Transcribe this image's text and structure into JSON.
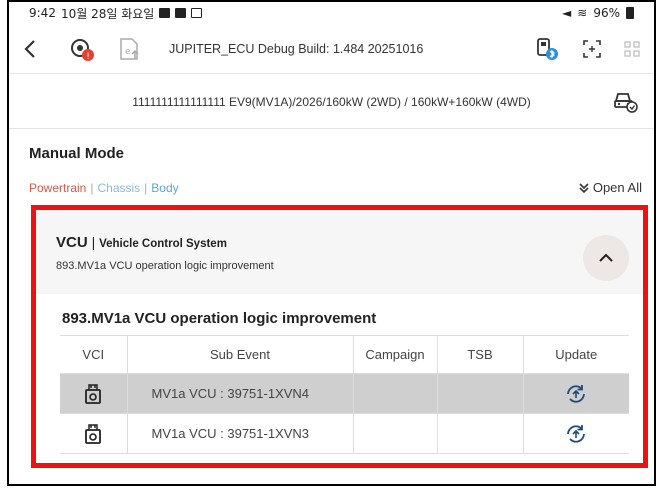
{
  "status_bar": {
    "time": "9:42",
    "date": "10월 28일 화요일",
    "battery": "96%"
  },
  "app_bar": {
    "title": "JUPITER_ECU Debug Build: 1.484 20251016",
    "icons": [
      "back-icon",
      "ecu-scan-icon",
      "file-upload-icon",
      "vci-bluetooth-icon",
      "fullscreen-icon",
      "grid-icon"
    ]
  },
  "vehicle": {
    "info": "1111111111111111  EV9(MV1A)/2026/160kW (2WD) / 160kW+160kW (4WD)"
  },
  "main": {
    "section_title": "Manual Mode",
    "categories": [
      "Powertrain",
      "Chassis",
      "Body"
    ],
    "open_all": "Open All",
    "card": {
      "system_code": "VCU",
      "system_name": "Vehicle Control System",
      "description": "893.MV1a VCU operation logic improvement",
      "group_title": "893.MV1a VCU operation logic improvement",
      "columns": [
        "VCI",
        "Sub Event",
        "Campaign",
        "TSB",
        "Update"
      ],
      "rows": [
        {
          "sub_event": "MV1a VCU : 39751-1XVN4",
          "campaign": "",
          "tsb": "",
          "selected": true
        },
        {
          "sub_event": "MV1a VCU : 39751-1XVN3",
          "campaign": "",
          "tsb": "",
          "selected": false
        }
      ]
    }
  },
  "colors": {
    "highlight_border": "#ee1111",
    "powertrain": "#d9574a",
    "chassis": "#8fb8d8",
    "body": "#57a9d9",
    "selected_row": "#cfcfcf"
  }
}
